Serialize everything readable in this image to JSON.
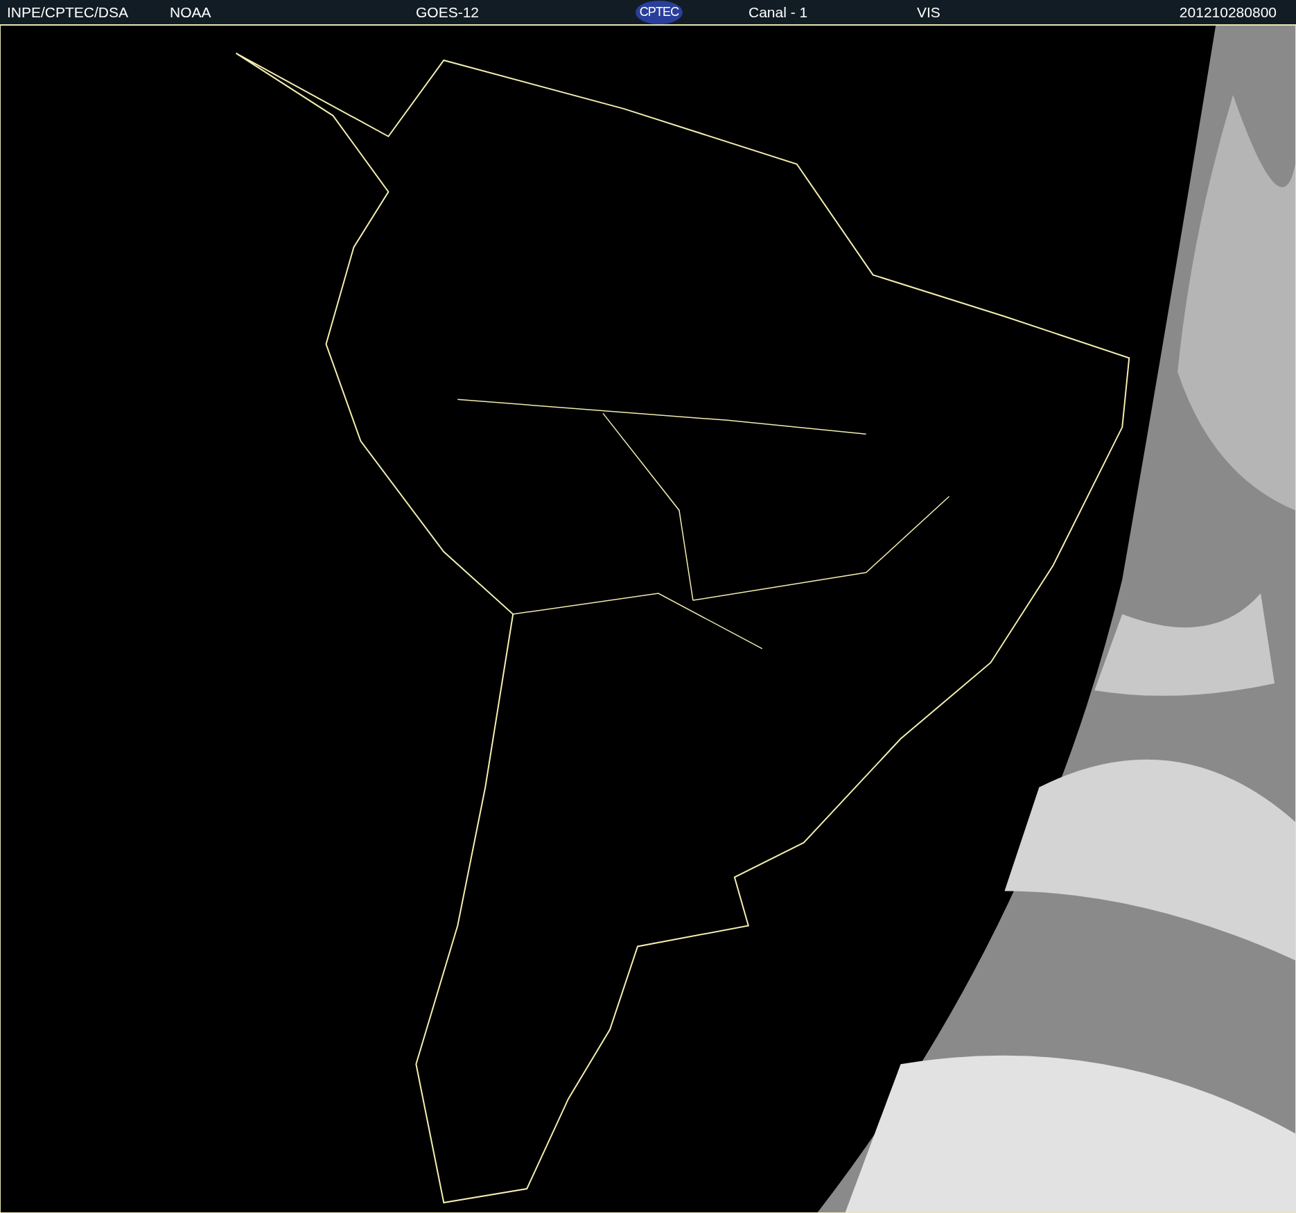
{
  "header": {
    "source": "INPE/CPTEC/DSA",
    "agency": "NOAA",
    "satellite": "GOES-12",
    "logo": "CPTEC",
    "channel": "Canal - 1",
    "band": "VIS",
    "timestamp": "201210280800"
  }
}
